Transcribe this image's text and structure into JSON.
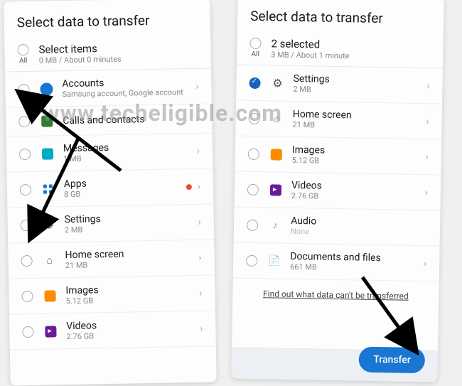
{
  "watermark": "www.techeligible.com",
  "left": {
    "title": "Select data to transfer",
    "all_label": "All",
    "select_title": "Select items",
    "select_sub": "0 MB / About 0 minutes",
    "items": [
      {
        "title": "Accounts",
        "sub": "Samsung account, Google account",
        "icon": "account"
      },
      {
        "title": "Calls and contacts",
        "sub": "",
        "icon": "calls"
      },
      {
        "title": "Messages",
        "sub": "1 MB",
        "icon": "messages"
      },
      {
        "title": "Apps",
        "sub": "8 GB",
        "icon": "apps",
        "badge": true
      },
      {
        "title": "Settings",
        "sub": "2 MB",
        "icon": "settings"
      },
      {
        "title": "Home screen",
        "sub": "21 MB",
        "icon": "home"
      },
      {
        "title": "Images",
        "sub": "5.12 GB",
        "icon": "images"
      },
      {
        "title": "Videos",
        "sub": "2.76 GB",
        "icon": "videos"
      }
    ]
  },
  "right": {
    "title": "Select data to transfer",
    "all_label": "All",
    "select_title": "2 selected",
    "select_sub": "3 MB / About 1 minute",
    "items": [
      {
        "title": "Settings",
        "sub": "2 MB",
        "icon": "settings",
        "checked": true
      },
      {
        "title": "Home screen",
        "sub": "21 MB",
        "icon": "home"
      },
      {
        "title": "Images",
        "sub": "5.12 GB",
        "icon": "images"
      },
      {
        "title": "Videos",
        "sub": "2.76 GB",
        "icon": "videos"
      },
      {
        "title": "Audio",
        "sub": "None",
        "icon": "audio",
        "none": true
      },
      {
        "title": "Documents and files",
        "sub": "661 MB",
        "icon": "docs"
      }
    ],
    "find_out": "Find out what data can't be transferred",
    "transfer_btn": "Transfer"
  }
}
